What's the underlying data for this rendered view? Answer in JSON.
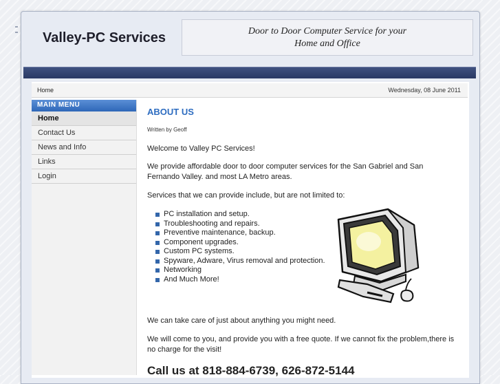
{
  "header": {
    "site_title": "Valley-PC Services",
    "tagline_line1": "Door to Door Computer Service for your",
    "tagline_line2": "Home and Office"
  },
  "breadcrumb": "Home",
  "date": "Wednesday, 08 June 2011",
  "sidebar": {
    "title": "MAIN MENU",
    "items": [
      {
        "label": "Home",
        "active": true
      },
      {
        "label": "Contact Us"
      },
      {
        "label": "News and Info"
      },
      {
        "label": "Links"
      },
      {
        "label": "Login"
      }
    ]
  },
  "article": {
    "title": "ABOUT US",
    "author": "Written by Geoff",
    "welcome": "Welcome to Valley PC Services!",
    "intro": "We provide affordable door to door computer services for the San Gabriel and  San Fernando Valley. and most LA Metro areas.",
    "services_intro": "Services that we can provide include, but are not limited to:",
    "services": [
      "PC installation and setup.",
      "Troubleshooting and repairs.",
      "Preventive maintenance, backup.",
      "Component upgrades.",
      "Custom PC systems.",
      "Spyware, Adware, Virus removal and protection.",
      "Networking",
      "And Much More!"
    ],
    "anything": "We can take care of just about anything you might need.",
    "quote": " We will come to you, and provide you with a free quote.  If we cannot fix the problem,there is no charge for the visit!",
    "call": "Call us at 818-884-6739, 626-872-5144"
  },
  "colors": {
    "accent": "#2d6cc0",
    "navbar": "#2a3964",
    "menu_header": "#3d76c6"
  },
  "icons": {
    "computer": "computer-illustration"
  }
}
